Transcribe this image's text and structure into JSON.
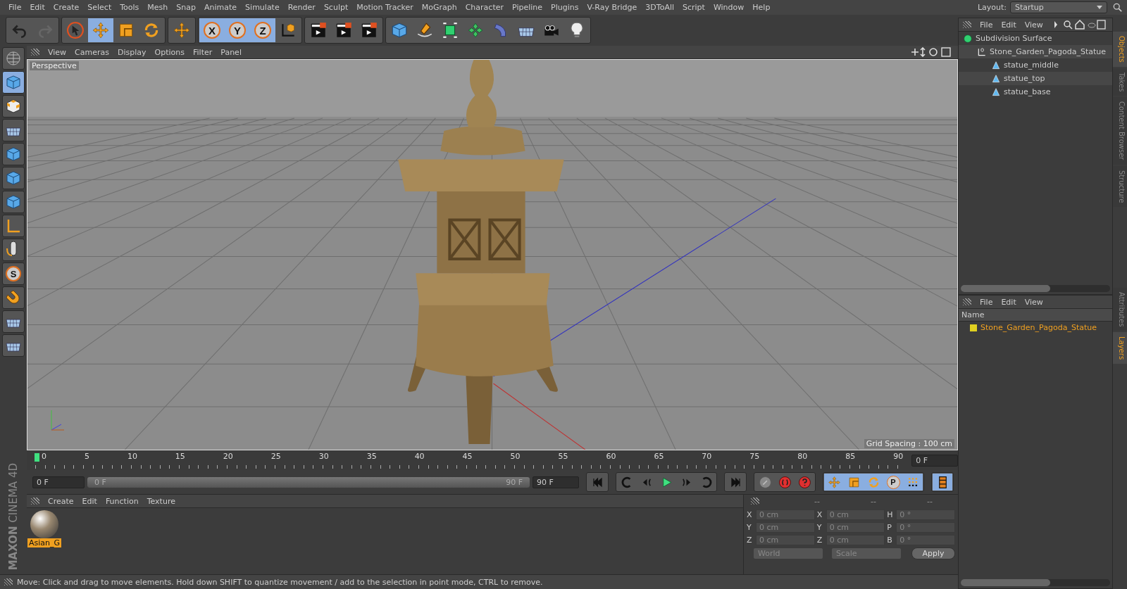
{
  "menu": [
    "File",
    "Edit",
    "Create",
    "Select",
    "Tools",
    "Mesh",
    "Snap",
    "Animate",
    "Simulate",
    "Render",
    "Sculpt",
    "Motion Tracker",
    "MoGraph",
    "Character",
    "Pipeline",
    "Plugins",
    "V-Ray Bridge",
    "3DToAll",
    "Script",
    "Window",
    "Help"
  ],
  "layout": {
    "label": "Layout:",
    "value": "Startup"
  },
  "toolbar": [
    [
      {
        "kind": "undo",
        "selected": false
      },
      {
        "kind": "redo",
        "selected": false
      }
    ],
    [
      {
        "kind": "pointer",
        "selected": false
      },
      {
        "kind": "move",
        "selected": true
      },
      {
        "kind": "scale",
        "selected": false
      },
      {
        "kind": "rotate",
        "selected": false
      }
    ],
    [
      {
        "kind": "move",
        "selected": false
      }
    ],
    [
      {
        "kind": "letter",
        "label": "X",
        "selected": true
      },
      {
        "kind": "letter",
        "label": "Y",
        "selected": true
      },
      {
        "kind": "letter",
        "label": "Z",
        "selected": true
      },
      {
        "kind": "coord",
        "selected": false
      }
    ],
    [
      {
        "kind": "clapper",
        "selected": false
      },
      {
        "kind": "clapper",
        "selected": false
      },
      {
        "kind": "clapper",
        "selected": false
      }
    ],
    [
      {
        "kind": "cube",
        "selected": false
      },
      {
        "kind": "pen",
        "selected": false
      },
      {
        "kind": "subdiv",
        "selected": false
      },
      {
        "kind": "cloner",
        "selected": false
      },
      {
        "kind": "bend",
        "selected": false
      },
      {
        "kind": "floor",
        "selected": false
      },
      {
        "kind": "camera",
        "selected": false
      },
      {
        "kind": "light",
        "selected": false
      }
    ]
  ],
  "tools": [
    {
      "kind": "globe",
      "selected": false
    },
    {
      "kind": "cube",
      "selected": true
    },
    {
      "kind": "checker",
      "selected": false
    },
    {
      "kind": "floor",
      "selected": false
    },
    {
      "kind": "cube",
      "selected": false
    },
    {
      "kind": "cube",
      "selected": false
    },
    {
      "kind": "cube",
      "selected": false
    },
    {
      "kind": "axis",
      "selected": false
    },
    {
      "kind": "mouse",
      "selected": false
    },
    {
      "kind": "letter",
      "label": "S",
      "selected": false
    },
    {
      "kind": "magnet",
      "selected": false
    },
    {
      "kind": "floor",
      "selected": false
    },
    {
      "kind": "floor",
      "selected": false
    }
  ],
  "viewport": {
    "menu": [
      "View",
      "Cameras",
      "Display",
      "Options",
      "Filter",
      "Panel"
    ],
    "camera": "Perspective",
    "grid_spacing": "Grid Spacing : 100 cm"
  },
  "timeline": {
    "ticks": [
      "0",
      "5",
      "10",
      "15",
      "20",
      "25",
      "30",
      "35",
      "40",
      "45",
      "50",
      "55",
      "60",
      "65",
      "70",
      "75",
      "80",
      "85",
      "90"
    ],
    "current": "0 F",
    "start": "0 F",
    "range": {
      "start": "0 F",
      "end": "90 F",
      "level": 1
    },
    "end": "90 F",
    "transport": [
      [
        {
          "kind": "first"
        }
      ],
      [
        {
          "kind": "prevkey"
        },
        {
          "kind": "prev"
        },
        {
          "kind": "play"
        },
        {
          "kind": "next"
        },
        {
          "kind": "nextkey"
        }
      ],
      [
        {
          "kind": "last"
        }
      ],
      [
        {
          "kind": "keygray"
        },
        {
          "kind": "record"
        },
        {
          "kind": "help"
        }
      ],
      [
        {
          "kind": "move"
        },
        {
          "kind": "scale"
        },
        {
          "kind": "rotate"
        },
        {
          "kind": "letter",
          "label": "P"
        },
        {
          "kind": "dots"
        }
      ],
      [
        {
          "kind": "film"
        }
      ]
    ]
  },
  "materials": {
    "menu": [
      "Create",
      "Edit",
      "Function",
      "Texture"
    ],
    "items": [
      {
        "name": "Asian_G",
        "selected": true
      }
    ]
  },
  "coordinates": {
    "headers": [
      "--",
      "--",
      "--"
    ],
    "rows": [
      [
        "X",
        "0 cm",
        "X",
        "0 cm",
        "H",
        "0 °"
      ],
      [
        "Y",
        "0 cm",
        "Y",
        "0 cm",
        "P",
        "0 °"
      ],
      [
        "Z",
        "0 cm",
        "Z",
        "0 cm",
        "B",
        "0 °"
      ]
    ],
    "mode": "World",
    "size_mode": "Scale",
    "apply": "Apply"
  },
  "status": "Move: Click and drag to move elements. Hold down SHIFT to quantize movement / add to the selection in point mode, CTRL to remove.",
  "logo": [
    "MAXON",
    "CINEMA 4D"
  ],
  "objects": {
    "menu": [
      "File",
      "Edit",
      "View"
    ],
    "tree": [
      {
        "name": "Subdivision Surface",
        "kind": "subdiv",
        "children": [
          {
            "name": "Stone_Garden_Pagoda_Statue",
            "kind": "null",
            "children": [
              {
                "name": "statue_middle",
                "kind": "poly"
              },
              {
                "name": "statue_top",
                "kind": "poly"
              },
              {
                "name": "statue_base",
                "kind": "poly"
              }
            ]
          }
        ]
      }
    ]
  },
  "side_tabs_top": [
    {
      "label": "Objects",
      "selected": true
    },
    {
      "label": "Takes",
      "selected": false
    },
    {
      "label": "Content Browser",
      "selected": false
    },
    {
      "label": "Structure",
      "selected": false
    }
  ],
  "layers": {
    "menu": [
      "File",
      "Edit",
      "View"
    ],
    "column": "Name",
    "rows": [
      {
        "name": "Stone_Garden_Pagoda_Statue",
        "color": "#e0d020"
      }
    ]
  },
  "side_tabs_bottom": [
    {
      "label": "Attributes",
      "selected": false
    },
    {
      "label": "Layers",
      "selected": true
    }
  ]
}
